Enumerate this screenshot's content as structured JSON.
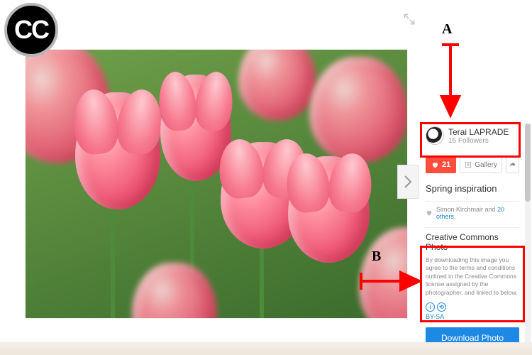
{
  "annotations": {
    "a_label": "A",
    "b_label": "B"
  },
  "expand": {
    "name": "expand-icon"
  },
  "nav": {
    "next": "next-image"
  },
  "sidebar": {
    "author": {
      "name": "Terai LAPRADE",
      "followers": "16 Followers"
    },
    "actions": {
      "like_count": "21",
      "gallery_label": "Gallery"
    },
    "title": "Spring inspiration",
    "liked_by": {
      "name": "Simon Kirchmair",
      "and": " and ",
      "others": "20 others",
      "dot": "."
    },
    "cc": {
      "heading": "Creative Commons Photo",
      "body": "By downloading this image you agree to the terms and conditions outlined in the Creative Commons license assigned by the photographer, and linked to below.",
      "license": "BY-SA"
    },
    "download": "Download Photo"
  }
}
